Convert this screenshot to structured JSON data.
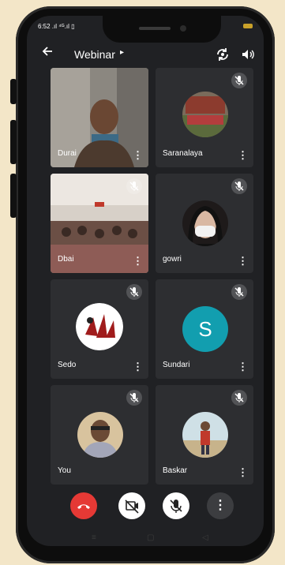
{
  "status": {
    "left": "6:52 .ıl ⁴ᴳ.ıl ▯"
  },
  "header": {
    "title": "Webinar",
    "title_caret": "▸"
  },
  "participants": [
    {
      "name": "Durai"
    },
    {
      "name": "Saranalaya"
    },
    {
      "name": "Dbai"
    },
    {
      "name": "gowri"
    },
    {
      "name": "Sedo"
    },
    {
      "name": "Sundari",
      "initial": "S"
    },
    {
      "name": "You"
    },
    {
      "name": "Baskar"
    }
  ],
  "colors": {
    "end_call": "#e53935",
    "sundari_avatar": "#129eaf",
    "tile_bg": "#2d2e31"
  },
  "icons": {
    "back": "back-arrow-icon",
    "switch_camera": "switch-camera-icon",
    "speaker": "speaker-icon",
    "mic_off": "mic-off-icon",
    "more": "more-vert-icon",
    "end_call": "phone-hangup-icon",
    "camera_off": "camera-off-icon"
  }
}
